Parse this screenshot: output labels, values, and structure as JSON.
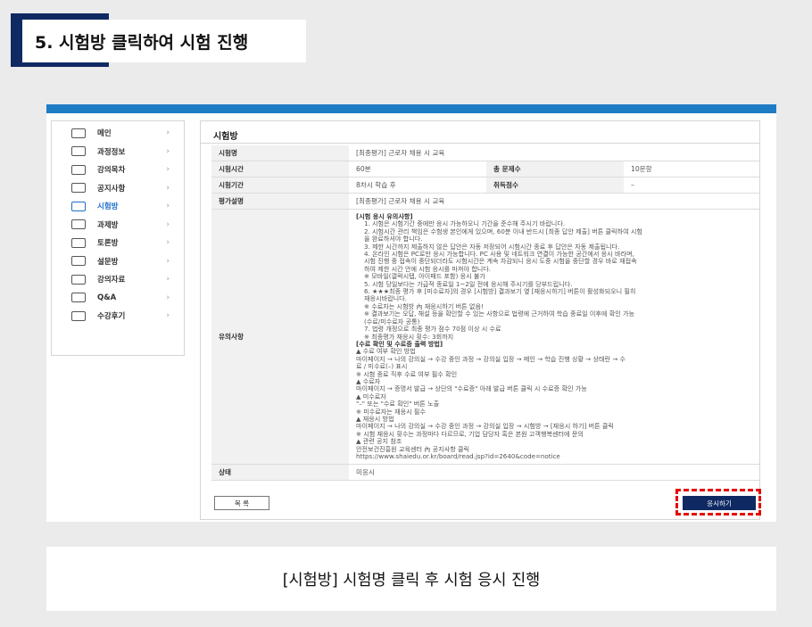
{
  "step_title": "5. 시험방 클릭하여 시험 진행",
  "sidebar": {
    "items": [
      {
        "label": "메인",
        "icon": "chat-icon",
        "active": false
      },
      {
        "label": "과정정보",
        "icon": "monitor-icon",
        "active": false
      },
      {
        "label": "강의목차",
        "icon": "list-icon",
        "active": false
      },
      {
        "label": "공지사항",
        "icon": "megaphone-icon",
        "active": false
      },
      {
        "label": "시험방",
        "icon": "exam-edit-icon",
        "active": true
      },
      {
        "label": "과제방",
        "icon": "document-icon",
        "active": false
      },
      {
        "label": "토론방",
        "icon": "discussion-icon",
        "active": false
      },
      {
        "label": "설문방",
        "icon": "survey-icon",
        "active": false
      },
      {
        "label": "강의자료",
        "icon": "books-icon",
        "active": false
      },
      {
        "label": "Q&A",
        "icon": "qa-icon",
        "active": false
      },
      {
        "label": "수강후기",
        "icon": "review-icon",
        "active": false
      }
    ],
    "chevron": "›"
  },
  "content": {
    "title": "시험방",
    "rows": {
      "name_label": "시험명",
      "name_value": "[최종평가] 근로자 채용 시 교육",
      "time_label": "시험시간",
      "time_value": "60분",
      "count_label": "총 문제수",
      "count_value": "10문항",
      "period_label": "시험기간",
      "period_value": "8차시 학습 후",
      "score_label": "취득점수",
      "score_value": "–",
      "desc_label": "평가설명",
      "desc_value": "[최종평가] 근로자 채용 시 교육",
      "notice_label": "유의사항",
      "status_label": "상태",
      "status_value": "미응시"
    },
    "notice_lines": [
      {
        "text": "[시험 응시 유의사항]",
        "bold": true,
        "indent": false
      },
      {
        "text": "1. 시험은 시험기간 중에만 응시 가능하오니 기간을 준수해 주시기 바랍니다.",
        "bold": false,
        "indent": true
      },
      {
        "text": "2. 시험시간 관리 책임은 수험생 본인에게 있으며, 60분 이내 반드시 [최종 답안 제출] 버튼 클릭하여 시험",
        "bold": false,
        "indent": true
      },
      {
        "text": "을 완료하셔야 합니다.",
        "bold": false,
        "indent": true
      },
      {
        "text": "3. 제한 시간까지 제출하지 않은 답안은 자동 저장되어 시험시간 종료 후 답안은 자동 제출됩니다.",
        "bold": false,
        "indent": true
      },
      {
        "text": "4. 온라인 시험은 PC로만 응시 가능합니다. PC 사용 및 네트워크 연결이 가능한 공간에서 응시 바라며,",
        "bold": false,
        "indent": true
      },
      {
        "text": "시험 진행 중 접속이 중단되더라도 시험시간은 계속 차감되니 응시 도중 시험을 중단할 경우 바로 재접속",
        "bold": false,
        "indent": true
      },
      {
        "text": "하여 제한 시간 안에 시험 응시를 마쳐야 합니다.",
        "bold": false,
        "indent": true
      },
      {
        "text": "※ 모바일(갤럭시탭, 아이패드 포함) 응시 불가",
        "bold": false,
        "indent": true
      },
      {
        "text": "5. 시험 당일보다는 가급적 종료일 1~2일 전에 응시해 주시기를 당부드립니다.",
        "bold": false,
        "indent": true
      },
      {
        "text": "6. ★★★최종 평가 후 [미수료자]의 경우 [시험방] 결과보기 옆 [재응시하기] 버튼이 활성화되오니 필히",
        "bold": false,
        "indent": true
      },
      {
        "text": "재응시바랍니다.",
        "bold": false,
        "indent": true
      },
      {
        "text": "※ 수료자는 시험방 內 재응시하기 버튼 없음!",
        "bold": false,
        "indent": true
      },
      {
        "text": "※ 결과보기는 오답, 해설 등을 확인할 수 있는 사항으로 법령에 근거하여 학습 종료일 이후에 확인 가능",
        "bold": false,
        "indent": true
      },
      {
        "text": "(수료/미수료자 공통)",
        "bold": false,
        "indent": true
      },
      {
        "text": "7. 법령 개정으로 최종 평가 점수 70점 이상 시 수료",
        "bold": false,
        "indent": true
      },
      {
        "text": "※ 최종평가 재응시 횟수: 3회까지",
        "bold": false,
        "indent": true
      },
      {
        "text": "[수료 확인 및 수료증 출력 방법]",
        "bold": true,
        "indent": false
      },
      {
        "text": "▲ 수료 여부 확인 방법",
        "bold": false,
        "indent": false
      },
      {
        "text": "마이페이지 → 나의 강의실 → 수강 중인 과정 → 강의실 입장 → 메인 → 학습 진행 상황 → 상태란 → 수",
        "bold": false,
        "indent": false
      },
      {
        "text": "료 / 미수료(–) 표시",
        "bold": false,
        "indent": false
      },
      {
        "text": "※ 시험 종료 직후 수료 여부 필수 확인",
        "bold": false,
        "indent": false
      },
      {
        "text": "▲ 수료자",
        "bold": false,
        "indent": false
      },
      {
        "text": "마이페이지 → 증명서 발급 → 상단의 \"수료증\" 아래 발급 버튼 클릭 시 수료증 확인 가능",
        "bold": false,
        "indent": false
      },
      {
        "text": "▲ 미수료자",
        "bold": false,
        "indent": false
      },
      {
        "text": "\"–\" 또는 \"수료 확인\" 버튼 노출",
        "bold": false,
        "indent": false
      },
      {
        "text": "※ 미수료자는 재응시 필수",
        "bold": false,
        "indent": false
      },
      {
        "text": "▲ 재응시 방법",
        "bold": false,
        "indent": false
      },
      {
        "text": "마이페이지 → 나의 강의실 → 수강 중인 과정 → 강의실 입장 → 시험방 → [재응시 하기] 버튼 클릭",
        "bold": false,
        "indent": false
      },
      {
        "text": "※ 시험 재응시 횟수는 과정마다 다르므로, 기업 담당자 혹은 본원 고객행복센터에 문의",
        "bold": false,
        "indent": false
      },
      {
        "text": "▲ 관련 공지 참조",
        "bold": false,
        "indent": false
      },
      {
        "text": "안전보건진흥원 교육센터 內 공지사항 클릭",
        "bold": false,
        "indent": false
      },
      {
        "text": "https://www.shaiedu.or.kr/board/read.jsp?id=2640&code=notice",
        "bold": false,
        "indent": false
      }
    ],
    "list_button": "목 록",
    "apply_button": "응시하기"
  },
  "caption": "[시험방] 시험명 클릭 후 시험 응시 진행",
  "colors": {
    "accent": "#0f2a63",
    "top_bar": "#1e7cc4",
    "highlight": "#e60000",
    "active": "#1e6fc9"
  }
}
